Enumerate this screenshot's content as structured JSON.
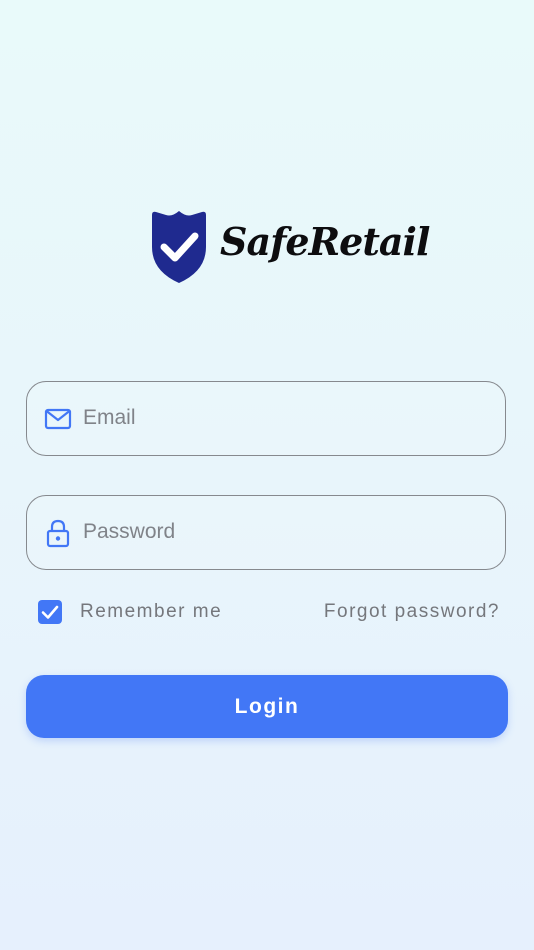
{
  "brand": {
    "name": "SafeRetail",
    "primary_color": "#1f2a8f",
    "accent_color": "#4277f6"
  },
  "login_form": {
    "email": {
      "placeholder": "Email",
      "value": "",
      "icon": "envelope-icon"
    },
    "password": {
      "placeholder": "Password",
      "value": "",
      "icon": "lock-icon"
    },
    "remember_me": {
      "label": "Remember me",
      "checked": true
    },
    "forgot_password_label": "Forgot password?",
    "login_label": "Login"
  }
}
